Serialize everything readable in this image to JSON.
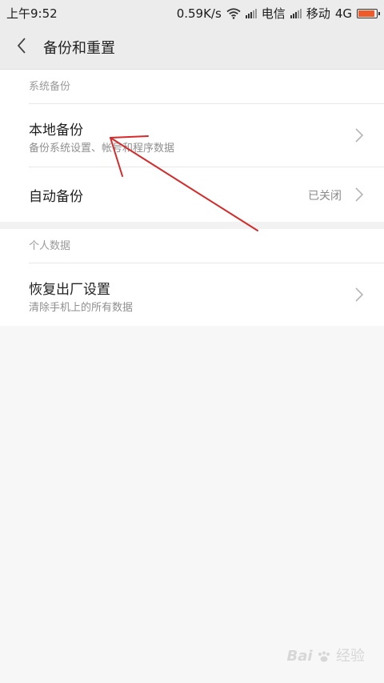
{
  "status_bar": {
    "time": "上午9:52",
    "speed": "0.59K/s",
    "carrier1": "电信",
    "carrier2": "移动",
    "network": "4G"
  },
  "header": {
    "title": "备份和重置"
  },
  "sections": [
    {
      "header": "系统备份",
      "items": [
        {
          "title": "本地备份",
          "subtitle": "备份系统设置、帐号和程序数据"
        },
        {
          "title": "自动备份",
          "value": "已关闭"
        }
      ]
    },
    {
      "header": "个人数据",
      "items": [
        {
          "title": "恢复出厂设置",
          "subtitle": "清除手机上的所有数据"
        }
      ]
    }
  ],
  "watermark": {
    "brand": "Bai",
    "text": "经验"
  },
  "colors": {
    "annotation_arrow": "#d62a2a",
    "battery": "#ef5a2b"
  }
}
